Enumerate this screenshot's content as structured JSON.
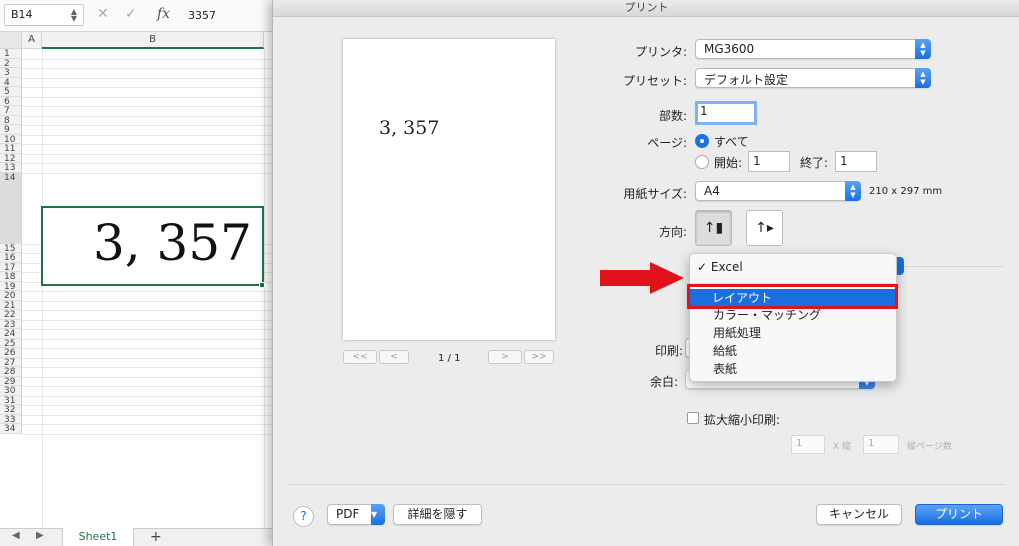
{
  "excel": {
    "name_box": "B14",
    "formula_value": "3357",
    "col_a": "A",
    "col_b": "B",
    "cell_display": "3, 357",
    "sheet_tab": "Sheet1",
    "add_tab": "+",
    "row_numbers": [
      "1",
      "2",
      "3",
      "4",
      "5",
      "6",
      "7",
      "8",
      "9",
      "10",
      "11",
      "12",
      "13",
      "14",
      "15",
      "16",
      "17",
      "18",
      "19",
      "20",
      "21",
      "22",
      "23",
      "24",
      "25",
      "26",
      "27",
      "28",
      "29",
      "30",
      "31",
      "32",
      "33",
      "34"
    ]
  },
  "dialog": {
    "title": "プリント",
    "preview_text": "3, 357",
    "page_counter": "1 / 1",
    "printer_label": "プリンタ:",
    "printer_value": "MG3600",
    "preset_label": "プリセット:",
    "preset_value": "デフォルト設定",
    "copies_label": "部数:",
    "copies_value": "1",
    "pages_label": "ページ:",
    "pages_all": "すべて",
    "pages_from": "開始:",
    "pages_from_value": "1",
    "pages_to": "終了:",
    "pages_to_value": "1",
    "paper_label": "用紙サイズ:",
    "paper_value": "A4",
    "paper_dims": "210 x 297 mm",
    "orientation_label": "方向:",
    "print_label": "印刷:",
    "margin_label": "余白:",
    "scale_label": "拡大縮小印刷:",
    "scale_w": "1",
    "scale_x": "X 縦",
    "scale_h": "1",
    "scale_pages": "縦ページ数",
    "help": "?",
    "pdf": "PDF",
    "hide_details": "詳細を隠す",
    "cancel": "キャンセル",
    "print": "プリント"
  },
  "menu": {
    "checked_mark": "✓",
    "items": [
      "Excel",
      "レイアウト",
      "カラー・マッチング",
      "用紙処理",
      "給紙",
      "表紙"
    ],
    "highlighted": "レイアウト"
  },
  "colors": {
    "excel_green": "#217346",
    "accent_blue": "#1a6fe0",
    "annotation_red": "#e0131c"
  }
}
